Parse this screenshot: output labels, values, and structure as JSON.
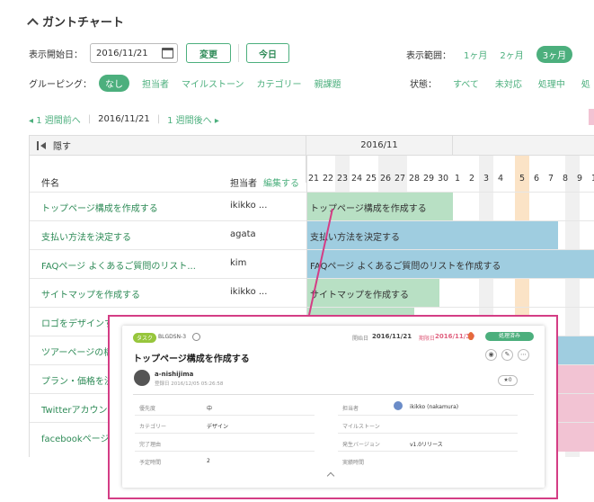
{
  "header": {
    "title": "ガントチャート"
  },
  "toolbar": {
    "start_label": "表示開始日：",
    "start_date": "2016/11/21",
    "change_button": "変更",
    "today_button": "今日",
    "range_label": "表示範囲：",
    "range_options": [
      "1ヶ月",
      "2ヶ月",
      "3ヶ月"
    ],
    "range_selected": "3ヶ月",
    "grouping_label": "グルーピング：",
    "grouping_options": [
      "なし",
      "担当者",
      "マイルストーン",
      "カテゴリー",
      "親課題"
    ],
    "grouping_selected": "なし",
    "state_label": "状態：",
    "state_options": [
      "すべて",
      "未対応",
      "処理中",
      "処"
    ]
  },
  "nav": {
    "prev": "1 週間前へ",
    "current": "2016/11/21",
    "next": "1 週間後へ"
  },
  "gantt": {
    "hide_label": "隠す",
    "month": "2016/11",
    "col_name": "件名",
    "col_owner": "担当者",
    "col_edit": "編集する",
    "days": [
      "21",
      "22",
      "23",
      "24",
      "25",
      "26",
      "27",
      "28",
      "29",
      "30",
      "1",
      "2",
      "3",
      "4",
      "5",
      "6",
      "7",
      "8",
      "9",
      "1"
    ],
    "rows": [
      {
        "name": "トップページ構成を作成する",
        "owner": "ikikko ...",
        "bar_label": "トップページ構成を作成する"
      },
      {
        "name": "支払い方法を決定する",
        "owner": "agata",
        "bar_label": "支払い方法を決定する"
      },
      {
        "name": "FAQページ よくあるご質問のリスト...",
        "owner": "kim",
        "bar_label": "FAQページ よくあるご質問のリストを作成する"
      },
      {
        "name": "サイトマップを作成する",
        "owner": "ikikko ...",
        "bar_label": "サイトマップを作成する"
      },
      {
        "name": "ロゴをデザインす",
        "owner": "",
        "bar_label": ""
      },
      {
        "name": "ツアーページの構",
        "owner": "",
        "bar_label": ""
      },
      {
        "name": "プラン・価格を決",
        "owner": "",
        "bar_label": ""
      },
      {
        "name": "Twitterアカウン",
        "owner": "",
        "bar_label": ""
      },
      {
        "name": "facebookページ",
        "owner": "",
        "bar_label": ""
      }
    ]
  },
  "popup": {
    "tag": "タスク",
    "key": "BLGDSN-3",
    "start_label": "開始日",
    "start_date": "2016/11/21",
    "due_label": "期限日",
    "due_date": "2016/11/30",
    "status": "処理済み",
    "title": "トップページ構成を作成する",
    "author": "a-nishijima",
    "registered": "登録日 2016/12/05 05:26:58",
    "stars": "★0",
    "fields_left": [
      {
        "label": "優先度",
        "value": "中"
      },
      {
        "label": "カテゴリー",
        "value": "デザイン"
      },
      {
        "label": "完了理由",
        "value": ""
      },
      {
        "label": "予定時間",
        "value": "2"
      }
    ],
    "fields_right": [
      {
        "label": "担当者",
        "value": "ikikko (nakamura)"
      },
      {
        "label": "マイルストーン",
        "value": ""
      },
      {
        "label": "発生バージョン",
        "value": "v1.0リリース"
      },
      {
        "label": "実績時間",
        "value": ""
      }
    ]
  },
  "colors": {
    "accent": "#4caf7d",
    "bar_green": "#b8e0c4",
    "bar_blue": "#9fcde0",
    "bar_pink": "#f2c3d3",
    "highlight": "#d43d85"
  }
}
